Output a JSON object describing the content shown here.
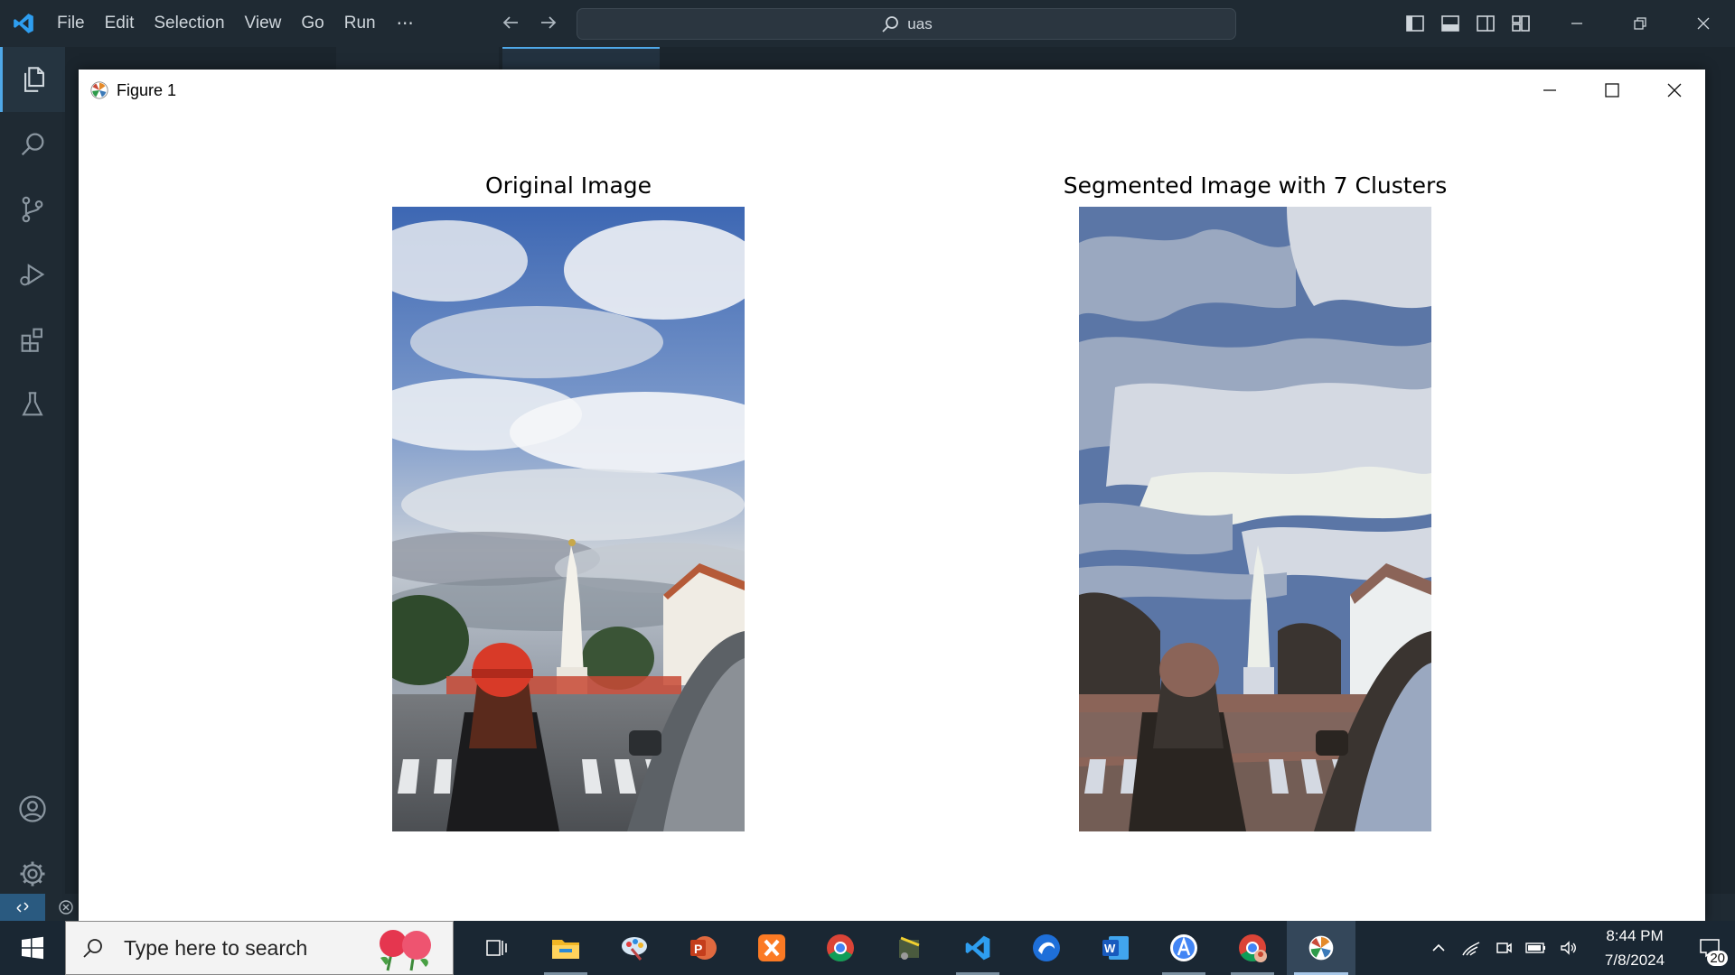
{
  "vscode": {
    "menu": [
      "File",
      "Edit",
      "Selection",
      "View",
      "Go",
      "Run"
    ],
    "more_label": "···",
    "search_text": "uas"
  },
  "figure": {
    "window_title": "Figure 1",
    "left_title": "Original Image",
    "right_title": "Segmented Image with 7 Clusters"
  },
  "taskbar": {
    "search_placeholder": "Type here to search",
    "time": "8:44 PM",
    "date": "7/8/2024",
    "notification_count": "20",
    "apps": [
      {
        "icon": "task-view-icon",
        "state": "normal"
      },
      {
        "icon": "file-explorer-icon",
        "state": "running"
      },
      {
        "icon": "paint-icon",
        "state": "normal"
      },
      {
        "icon": "powerpoint-icon",
        "state": "normal"
      },
      {
        "icon": "xampp-icon",
        "state": "normal"
      },
      {
        "icon": "chrome-icon",
        "state": "normal"
      },
      {
        "icon": "app-icon",
        "state": "normal"
      },
      {
        "icon": "vscode-icon",
        "state": "running"
      },
      {
        "icon": "browser-icon",
        "state": "normal"
      },
      {
        "icon": "word-icon",
        "state": "normal"
      },
      {
        "icon": "android-studio-icon",
        "state": "running"
      },
      {
        "icon": "chrome-profile-icon",
        "state": "running"
      },
      {
        "icon": "matplotlib-icon",
        "state": "active"
      }
    ]
  },
  "colors": {
    "vscode_bg": "#1f2a33",
    "taskbar_bg": "#1a2733",
    "accent": "#4fa8e8"
  }
}
